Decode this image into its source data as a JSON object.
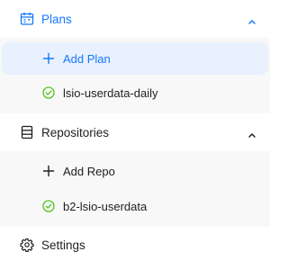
{
  "sections": {
    "plans": {
      "label": "Plans",
      "icon": "calendar-icon",
      "expanded": true,
      "add_label": "Add Plan",
      "items": [
        {
          "label": "lsio-userdata-daily",
          "status_icon": "check-circle-icon"
        }
      ]
    },
    "repositories": {
      "label": "Repositories",
      "icon": "database-icon",
      "expanded": true,
      "add_label": "Add Repo",
      "items": [
        {
          "label": "b2-lsio-userdata",
          "status_icon": "check-circle-icon"
        }
      ]
    },
    "settings": {
      "label": "Settings",
      "icon": "gear-icon"
    }
  },
  "colors": {
    "accent": "#1677ff",
    "active_bg": "#e8f1fd",
    "subgroup_bg": "#f8f8f8",
    "success": "#52c41a",
    "text": "#1f1f1f"
  }
}
